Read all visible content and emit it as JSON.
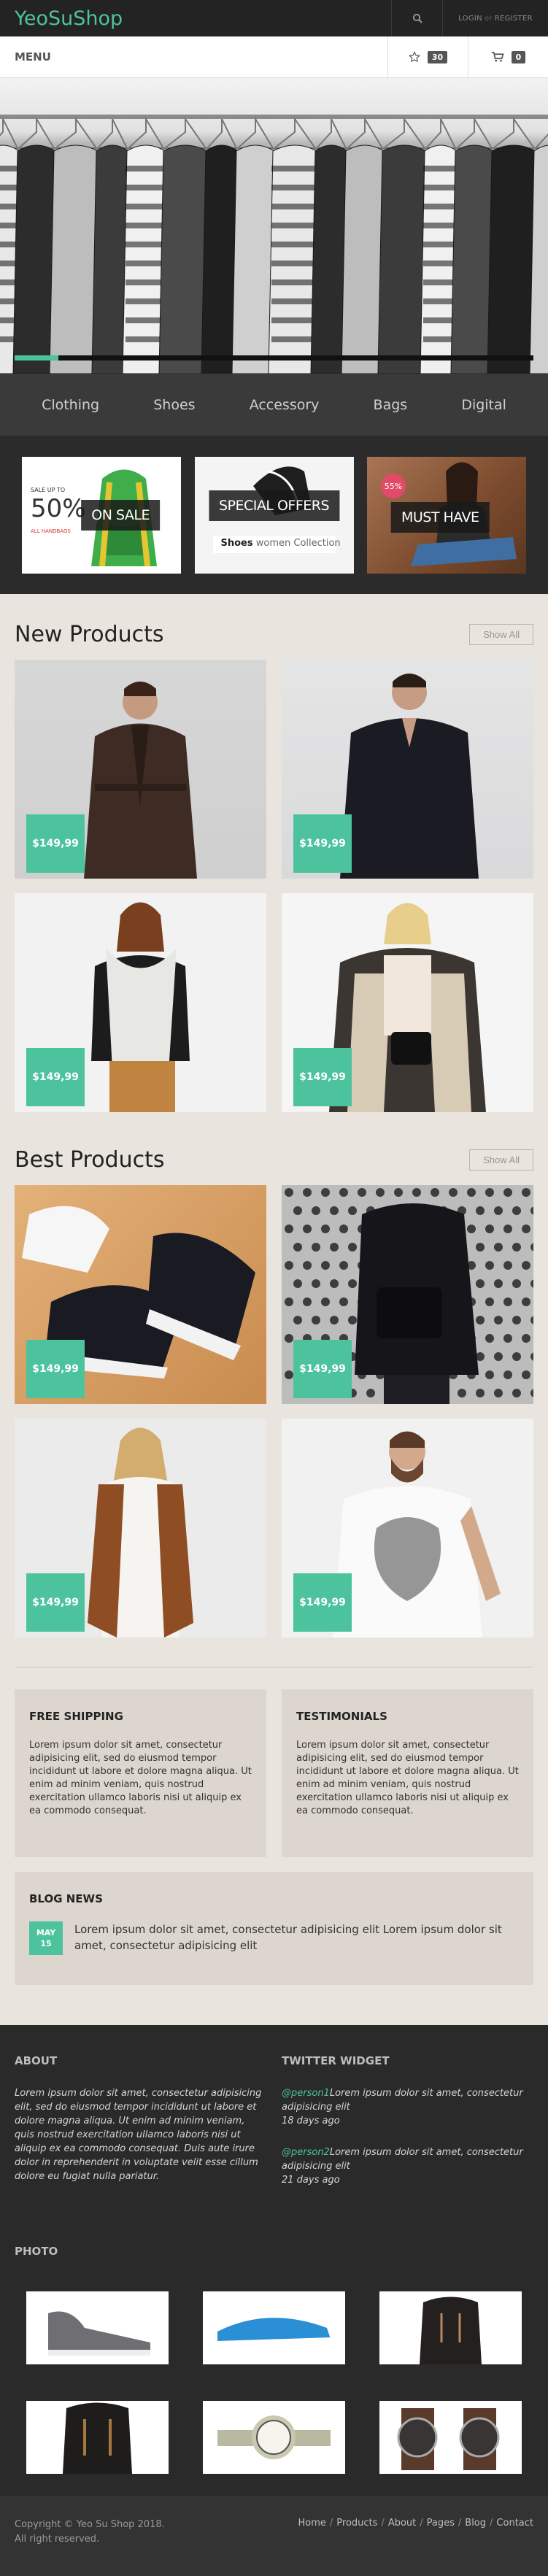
{
  "header": {
    "brand": "YeoSuShop",
    "login_label": "LOGIN",
    "or_label": "or",
    "register_label": "REGISTER",
    "search_icon": "search-icon"
  },
  "menubar": {
    "menu_label": "MENU",
    "favorites_count": "30",
    "cart_count": "0",
    "favorites_icon": "star-icon",
    "cart_icon": "cart-icon"
  },
  "hero": {
    "slider_progress": 0.085
  },
  "categories": [
    "Clothing",
    "Shoes",
    "Accessory",
    "Bags",
    "Digital"
  ],
  "promos": [
    {
      "label": "ON SALE",
      "corner": "50%",
      "tag": "SALE UP TO",
      "sub": "ALL HANDBAGS"
    },
    {
      "label": "SPECIAL OFFERS",
      "sub_strong": "Shoes",
      "sub_light": "women Collection"
    },
    {
      "label": "MUST HAVE",
      "badge": "55%"
    }
  ],
  "new_products": {
    "title": "New Products",
    "show_all": "Show All",
    "items": [
      {
        "price": "$149,99"
      },
      {
        "price": "$149,99"
      },
      {
        "price": "$149,99"
      },
      {
        "price": "$149,99"
      }
    ]
  },
  "best_products": {
    "title": "Best Products",
    "show_all": "Show All",
    "items": [
      {
        "price": "$149,99"
      },
      {
        "price": "$149,99"
      },
      {
        "price": "$149,99"
      },
      {
        "price": "$149,99"
      }
    ]
  },
  "info": {
    "shipping_title": "FREE SHIPPING",
    "shipping_text": "Lorem ipsum dolor sit amet, consectetur adipisicing elit, sed do eiusmod tempor incididunt ut labore et dolore magna aliqua. Ut enim ad minim veniam, quis nostrud exercitation ullamco laboris nisi ut aliquip ex ea commodo consequat.",
    "testimonials_title": "TESTIMONIALS",
    "testimonials_text": "Lorem ipsum dolor sit amet, consectetur adipisicing elit, sed do eiusmod tempor incididunt ut labore et dolore magna aliqua. Ut enim ad minim veniam, quis nostrud exercitation ullamco laboris nisi ut aliquip ex ea commodo consequat."
  },
  "blog": {
    "title": "BLOG NEWS",
    "month": "MAY",
    "day": "15",
    "text": "Lorem ipsum dolor sit amet, consectetur adipisicing elit Lorem ipsum dolor sit amet, consectetur adipisicing elit"
  },
  "footer": {
    "about_title": "ABOUT",
    "about_text": "Lorem ipsum dolor sit amet, consectetur adipisicing elit, sed do eiusmod tempor incididunt ut labore et dolore magna aliqua. Ut enim ad minim veniam, quis nostrud exercitation ullamco laboris nisi ut aliquip ex ea commodo consequat. Duis aute irure dolor in reprehenderit in voluptate velit esse cillum dolore eu fugiat nulla pariatur.",
    "twitter_title": "TWITTER WIDGET",
    "tweets": [
      {
        "handle": "@person1",
        "text": "Lorem ipsum dolor sit amet, consectetur adipisicing elit",
        "time": "18 days ago"
      },
      {
        "handle": "@person2",
        "text": "Lorem ipsum dolor sit amet, consectetur adipisicing elit",
        "time": "21 days ago"
      }
    ],
    "photo_title": "PHOTO",
    "copyright": "Copyright © Yeo Su Shop 2018.",
    "rights": "All right reserved.",
    "links": [
      "Home",
      "Products",
      "About",
      "Pages",
      "Blog",
      "Contact"
    ]
  },
  "colors": {
    "accent": "#4dc39d",
    "dark": "#232323",
    "page_bg": "#e9e4dd"
  }
}
